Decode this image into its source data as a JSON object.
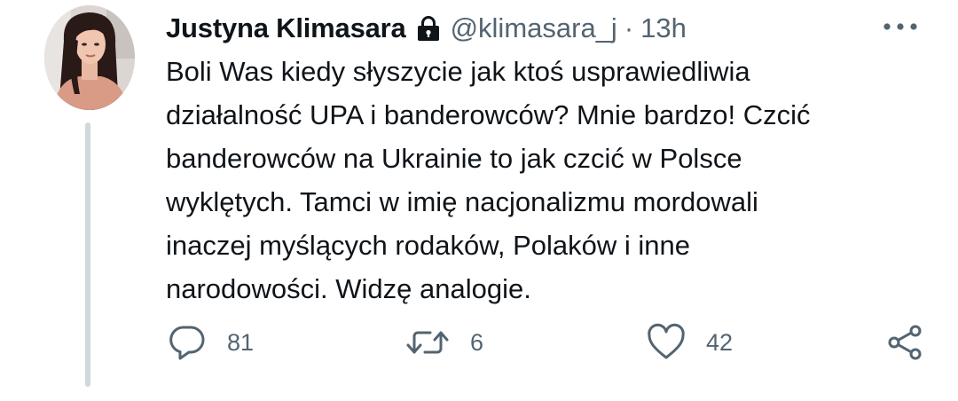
{
  "tweet": {
    "author_name": "Justyna Klimasara",
    "handle": "@klimasara_j",
    "separator": "·",
    "time": "13h",
    "text_lines": [
      "Boli Was kiedy słyszycie jak ktoś usprawiedliwia",
      "działalność UPA i banderowców? Mnie bardzo! Czcić",
      "banderowców na Ukrainie to jak czcić w Polsce",
      "wyklętych. Tamci w imię nacjonalizmu mordowali",
      "inaczej myślących rodaków, Polaków i inne",
      "narodowości. Widzę analogie."
    ],
    "protected_icon": "lock-icon",
    "more_icon": "more-options-icon"
  },
  "actions": {
    "reply": {
      "icon": "reply-icon",
      "count": "81"
    },
    "retweet": {
      "icon": "retweet-icon",
      "count": "6"
    },
    "like": {
      "icon": "heart-icon",
      "count": "42"
    },
    "share": {
      "icon": "share-icon"
    }
  },
  "colors": {
    "text_primary": "#0f1419",
    "text_secondary": "#536471",
    "thread_line": "#cfd9de",
    "background": "#ffffff"
  }
}
